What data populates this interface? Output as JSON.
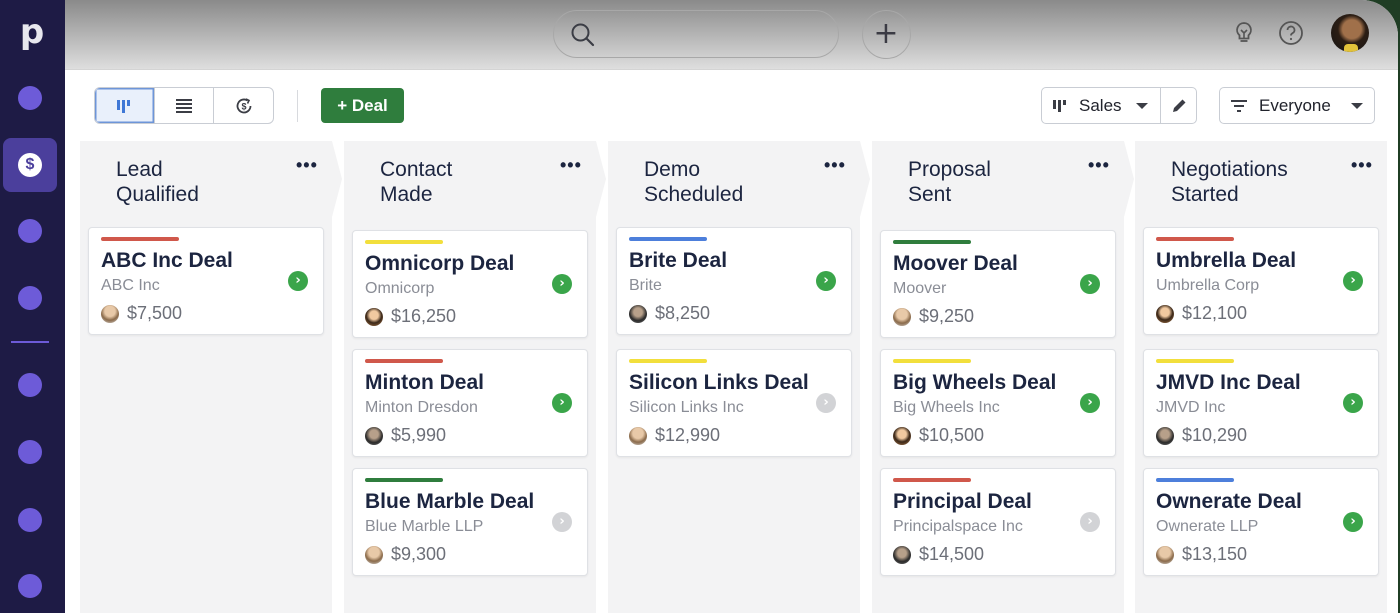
{
  "app": {
    "logo": "p"
  },
  "sidebar": {
    "active_icon": "$",
    "items": [
      "nav-item-1",
      "deals",
      "nav-item-3",
      "nav-item-4",
      "nav-item-5",
      "nav-item-6",
      "nav-item-7",
      "nav-item-8"
    ]
  },
  "topbar": {
    "search_placeholder": "",
    "add_label": "+",
    "icons": [
      "search-icon",
      "plus-icon",
      "lightbulb-icon",
      "help-icon",
      "user-avatar"
    ]
  },
  "toolbar": {
    "views": [
      {
        "name": "pipeline-view",
        "icon": "kanban-icon",
        "active": true
      },
      {
        "name": "list-view",
        "icon": "list-icon",
        "active": false
      },
      {
        "name": "forecast-view",
        "icon": "forecast-dollar-icon",
        "active": false
      }
    ],
    "add_deal_label": "+ Deal",
    "pipeline_label": "Sales",
    "filter_label": "Everyone"
  },
  "colors": {
    "red": "#d0584b",
    "yellow": "#f2df3c",
    "green": "#2f7d3d",
    "blue": "#4d7fdb",
    "go_active": "#3aa54a",
    "go_inactive": "#d2d3d6",
    "sidebar_bg": "#1e1b45",
    "sidebar_dot": "#6d5bd8"
  },
  "stages": [
    {
      "title": "Lead\nQualified",
      "deals": [
        {
          "title": "ABC Inc Deal",
          "org": "ABC Inc",
          "value": "$7,500",
          "label_color": "red",
          "active": true
        }
      ]
    },
    {
      "title": "Contact\nMade",
      "deals": [
        {
          "title": "Omnicorp Deal",
          "org": "Omnicorp",
          "value": "$16,250",
          "label_color": "yellow",
          "active": true
        },
        {
          "title": "Minton Deal",
          "org": "Minton Dresdon",
          "value": "$5,990",
          "label_color": "red",
          "active": true
        },
        {
          "title": "Blue Marble Deal",
          "org": "Blue Marble LLP",
          "value": "$9,300",
          "label_color": "green",
          "active": false
        }
      ]
    },
    {
      "title": "Demo\nScheduled",
      "deals": [
        {
          "title": "Brite Deal",
          "org": "Brite",
          "value": "$8,250",
          "label_color": "blue",
          "active": true
        },
        {
          "title": "Silicon Links Deal",
          "org": "Silicon Links Inc",
          "value": "$12,990",
          "label_color": "yellow",
          "active": false
        }
      ]
    },
    {
      "title": "Proposal\nSent",
      "deals": [
        {
          "title": "Moover Deal",
          "org": "Moover",
          "value": "$9,250",
          "label_color": "green",
          "active": true
        },
        {
          "title": "Big Wheels Deal",
          "org": "Big Wheels Inc",
          "value": "$10,500",
          "label_color": "yellow",
          "active": true
        },
        {
          "title": "Principal Deal",
          "org": "Principalspace Inc",
          "value": "$14,500",
          "label_color": "red",
          "active": false
        }
      ]
    },
    {
      "title": "Negotiations\nStarted",
      "deals": [
        {
          "title": "Umbrella Deal",
          "org": "Umbrella Corp",
          "value": "$12,100",
          "label_color": "red",
          "active": true
        },
        {
          "title": "JMVD Inc Deal",
          "org": "JMVD Inc",
          "value": "$10,290",
          "label_color": "yellow",
          "active": true
        },
        {
          "title": "Ownerate Deal",
          "org": "Ownerate LLP",
          "value": "$13,150",
          "label_color": "blue",
          "active": true
        }
      ]
    }
  ],
  "column_menu_label": "•••",
  "go_label": "›"
}
